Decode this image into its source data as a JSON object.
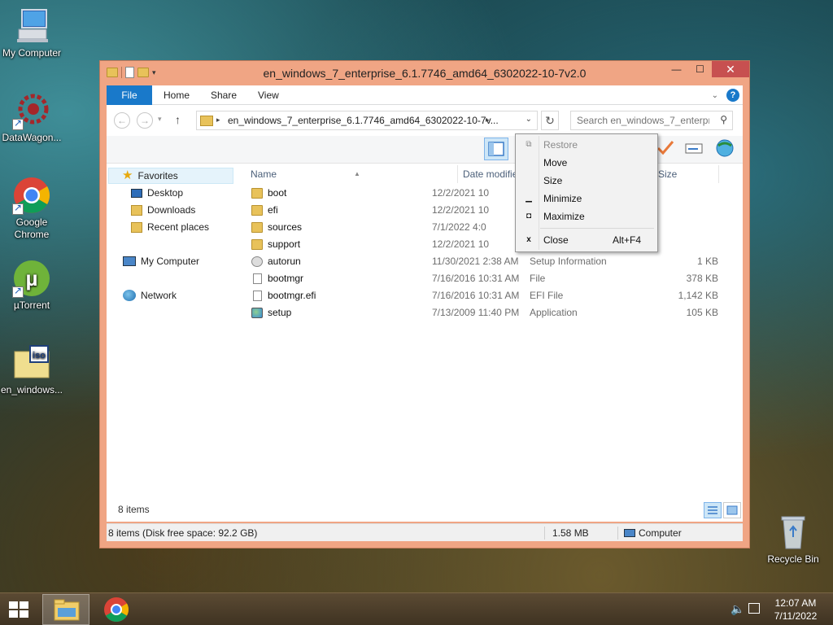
{
  "desktop": {
    "icons": [
      {
        "label": "My Computer",
        "icon": "computer-icon"
      },
      {
        "label": "DataWagon...",
        "icon": "datawagon-icon"
      },
      {
        "label": "Google Chrome",
        "icon": "chrome-icon"
      },
      {
        "label": "µTorrent",
        "icon": "utorrent-icon"
      },
      {
        "label": "en_windows...",
        "icon": "iso-file-icon"
      },
      {
        "label": "Recycle Bin",
        "icon": "recycle-bin-icon"
      }
    ]
  },
  "window": {
    "title": "en_windows_7_enterprise_6.1.7746_amd64_6302022-10-7v2.0",
    "caption": {
      "minimize": "—",
      "maximize": "☐",
      "close": "✕"
    },
    "ribbon_tabs": [
      "File",
      "Home",
      "Share",
      "View"
    ],
    "address": {
      "path": "en_windows_7_enterprise_6.1.7746_amd64_6302022-10-7v...",
      "search_placeholder": "Search en_windows_7_enterpr..."
    },
    "nav": {
      "favorites": "Favorites",
      "desktop": "Desktop",
      "downloads": "Downloads",
      "recent": "Recent places",
      "computer": "My Computer",
      "network": "Network"
    },
    "columns": {
      "name": "Name",
      "date": "Date modifie",
      "size": "Size"
    },
    "files": [
      {
        "name": "boot",
        "date": "12/2/2021 10",
        "type": "",
        "size": "",
        "icon": "folder-icon"
      },
      {
        "name": "efi",
        "date": "12/2/2021 10",
        "type": "",
        "size": "",
        "icon": "folder-icon"
      },
      {
        "name": "sources",
        "date": "7/1/2022 4:0",
        "type": "",
        "size": "",
        "icon": "folder-icon"
      },
      {
        "name": "support",
        "date": "12/2/2021 10",
        "type": "",
        "size": "",
        "icon": "folder-icon"
      },
      {
        "name": "autorun",
        "date": "11/30/2021 2:38 AM",
        "type": "Setup Information",
        "size": "1 KB",
        "icon": "settings-file-icon"
      },
      {
        "name": "bootmgr",
        "date": "7/16/2016 10:31 AM",
        "type": "File",
        "size": "378 KB",
        "icon": "file-icon"
      },
      {
        "name": "bootmgr.efi",
        "date": "7/16/2016 10:31 AM",
        "type": "EFI File",
        "size": "1,142 KB",
        "icon": "file-icon"
      },
      {
        "name": "setup",
        "date": "7/13/2009 11:40 PM",
        "type": "Application",
        "size": "105 KB",
        "icon": "setup-icon"
      }
    ],
    "item_count": "8 items",
    "statusbar": {
      "left": "8 items (Disk free space: 92.2 GB)",
      "size": "1.58 MB",
      "location": "Computer"
    }
  },
  "context_menu": {
    "items": [
      {
        "label": "Restore",
        "accel": "",
        "enabled": false
      },
      {
        "label": "Move",
        "accel": "",
        "enabled": true
      },
      {
        "label": "Size",
        "accel": "",
        "enabled": true
      },
      {
        "label": "Minimize",
        "accel": "",
        "enabled": true
      },
      {
        "label": "Maximize",
        "accel": "",
        "enabled": true
      },
      {
        "label": "Close",
        "accel": "Alt+F4",
        "enabled": true
      }
    ]
  },
  "taskbar": {
    "time": "12:07 AM",
    "date": "7/11/2022"
  },
  "colors": {
    "window_frame": "#f0a584",
    "close_button": "#c75050",
    "file_tab": "#1979ca",
    "taskbar": "#4a3c28"
  }
}
